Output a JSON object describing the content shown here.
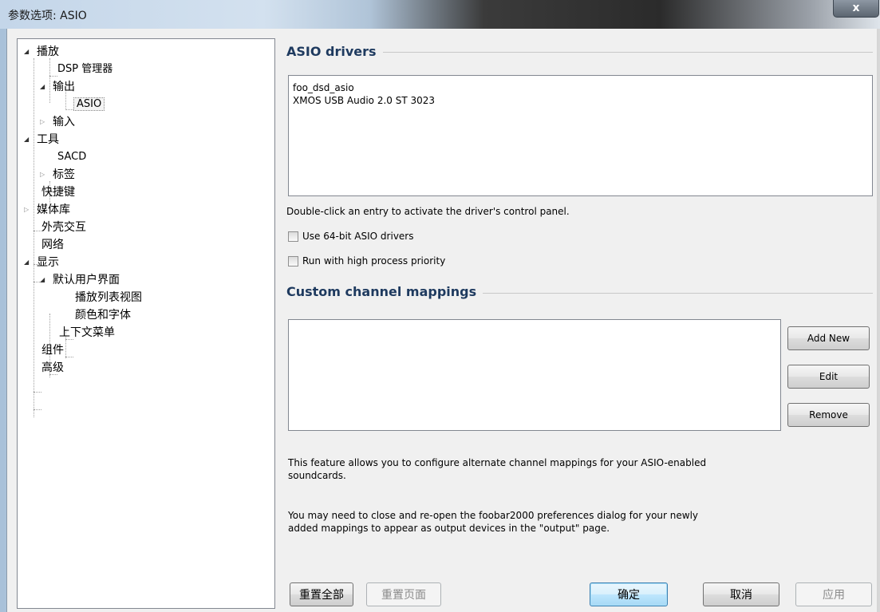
{
  "window": {
    "title": "参数选项: ASIO",
    "close_label": "x"
  },
  "tree": {
    "items": [
      {
        "label": "播放"
      },
      {
        "label": "DSP 管理器"
      },
      {
        "label": "输出"
      },
      {
        "label": "ASIO"
      },
      {
        "label": "输入"
      },
      {
        "label": "工具"
      },
      {
        "label": "SACD"
      },
      {
        "label": "标签"
      },
      {
        "label": "快捷键"
      },
      {
        "label": "媒体库"
      },
      {
        "label": "外壳交互"
      },
      {
        "label": "网络"
      },
      {
        "label": "显示"
      },
      {
        "label": "默认用户界面"
      },
      {
        "label": "播放列表视图"
      },
      {
        "label": "颜色和字体"
      },
      {
        "label": "上下文菜单"
      },
      {
        "label": "组件"
      },
      {
        "label": "高级"
      }
    ]
  },
  "asio": {
    "section_title": "ASIO drivers",
    "drivers": [
      "foo_dsd_asio",
      "XMOS USB Audio 2.0 ST 3023"
    ],
    "hint": "Double-click an entry to activate the driver's control panel.",
    "use64_label": "Use 64-bit ASIO drivers",
    "use64_checked": false,
    "priority_label": "Run with high process priority",
    "priority_checked": false
  },
  "mappings": {
    "section_title": "Custom channel mappings",
    "add_label": "Add New",
    "edit_label": "Edit",
    "remove_label": "Remove",
    "info1_line1": "This feature allows you to configure alternate channel mappings for your ASIO-enabled",
    "info1_line2": "soundcards.",
    "info2_line1": "You may need to close and re-open the foobar2000 preferences dialog for your newly",
    "info2_line2": "added mappings to appear as output devices in the \"output\" page."
  },
  "footer": {
    "reset_all": "重置全部",
    "reset_page": "重置页面",
    "ok": "确定",
    "cancel": "取消",
    "apply": "应用"
  },
  "icons": {
    "expanded": "expanded-triangle-icon",
    "collapsed": "collapsed-triangle-icon",
    "close": "close-icon"
  }
}
